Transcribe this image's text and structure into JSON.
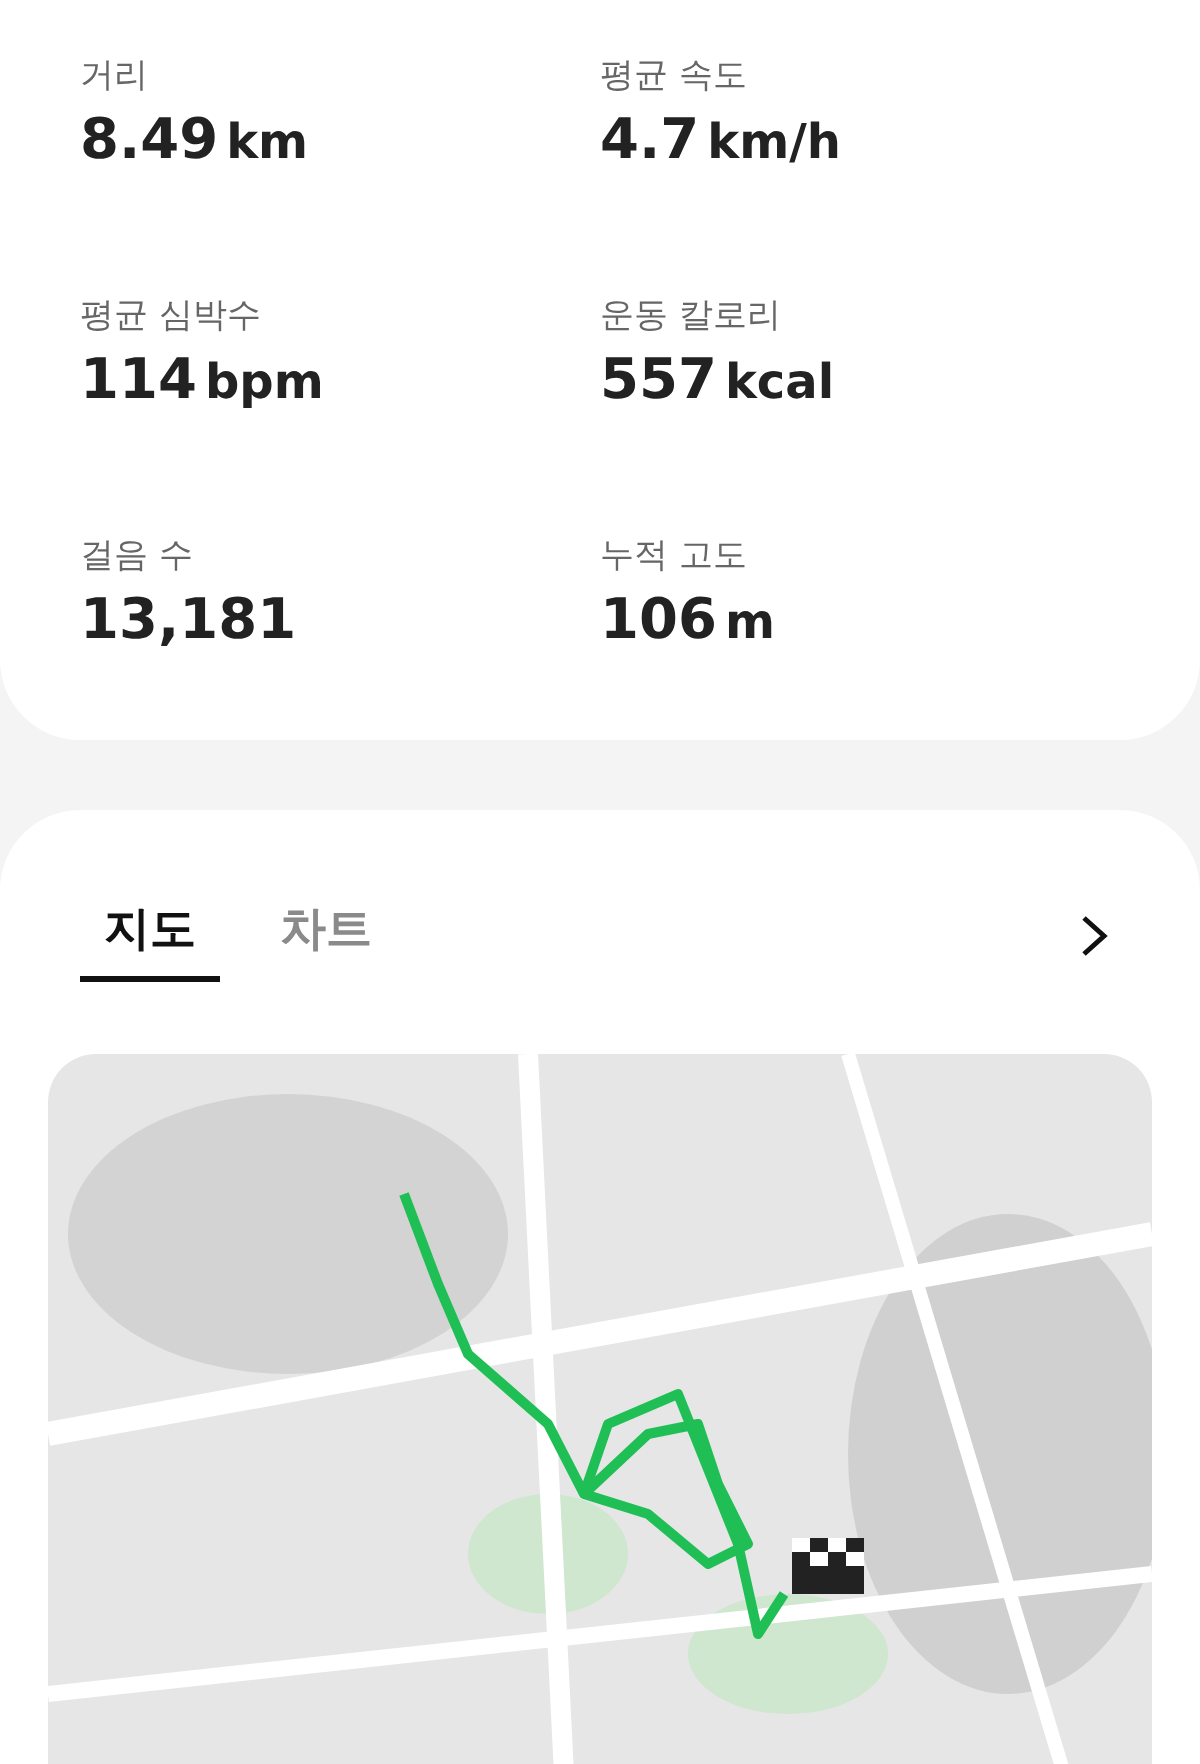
{
  "stats": [
    {
      "label": "거리",
      "value": "8.49",
      "unit": "km"
    },
    {
      "label": "평균 속도",
      "value": "4.7",
      "unit": "km/h"
    },
    {
      "label": "평균 심박수",
      "value": "114",
      "unit": "bpm"
    },
    {
      "label": "운동 칼로리",
      "value": "557",
      "unit": "kcal"
    },
    {
      "label": "걸음 수",
      "value": "13,181"
    },
    {
      "label": "누적 고도",
      "value": "106",
      "unit": "m"
    }
  ],
  "tabs": [
    {
      "label": "지도",
      "selected": true
    },
    {
      "label": "차트",
      "selected": false
    }
  ]
}
